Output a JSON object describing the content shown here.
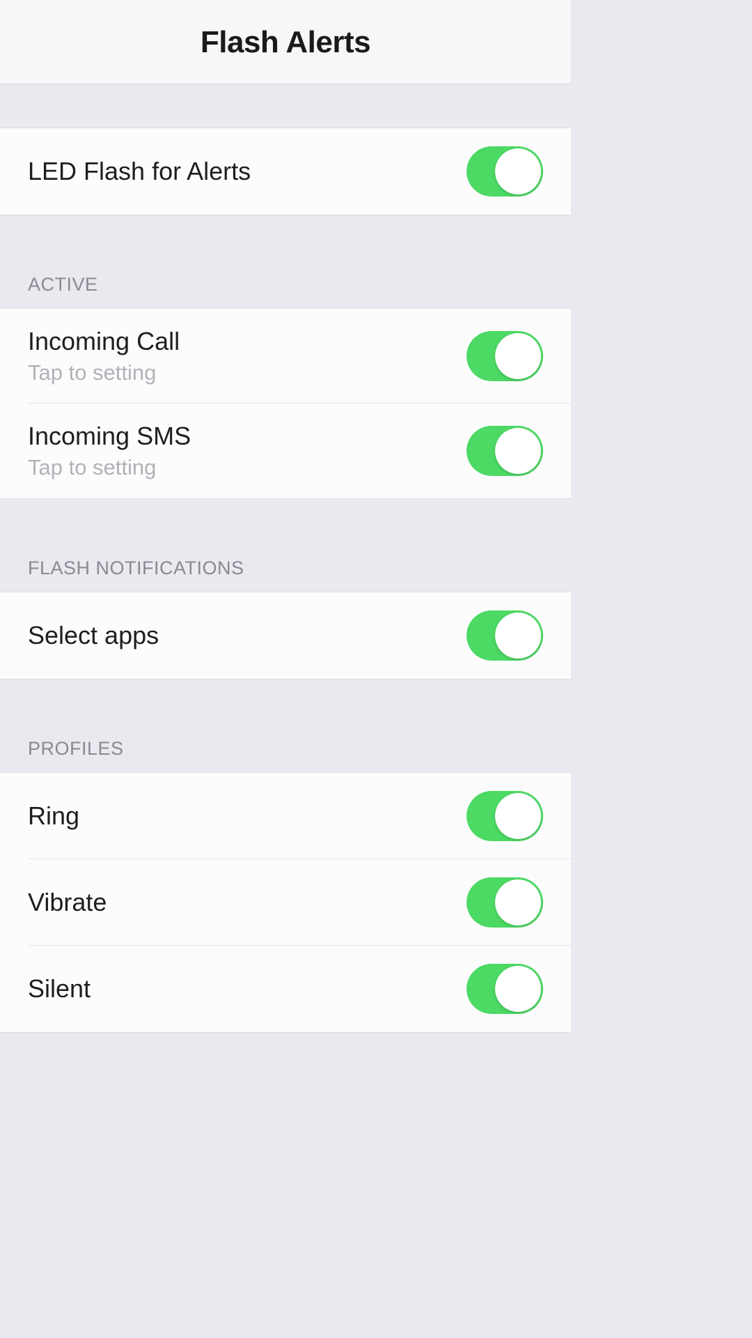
{
  "header": {
    "title": "Flash Alerts"
  },
  "sections": {
    "main": {
      "led_flash_label": "LED Flash for Alerts"
    },
    "active": {
      "header": "ACTIVE",
      "incoming_call_label": "Incoming Call",
      "incoming_call_subtitle": "Tap to setting",
      "incoming_sms_label": "Incoming SMS",
      "incoming_sms_subtitle": "Tap to setting"
    },
    "flash_notifications": {
      "header": "FLASH NOTIFICATIONS",
      "select_apps_label": "Select apps"
    },
    "profiles": {
      "header": "PROFILES",
      "ring_label": "Ring",
      "vibrate_label": "Vibrate",
      "silent_label": "Silent"
    }
  }
}
